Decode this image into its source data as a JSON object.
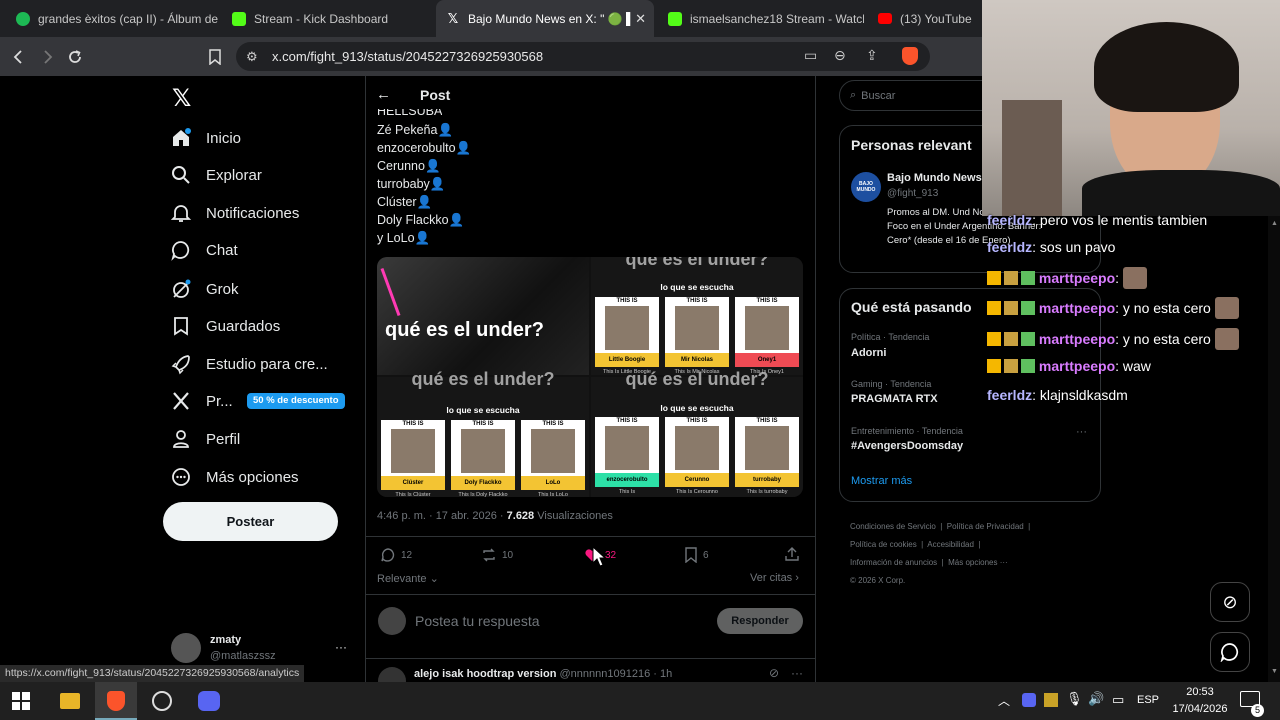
{
  "browser": {
    "tabs": [
      {
        "title": "grandes èxitos (cap II) - Álbum de",
        "favicon_color": "#1db954"
      },
      {
        "title": "Stream - Kick Dashboard",
        "favicon_color": "#53fc18"
      },
      {
        "title": "Bajo Mundo News en X: \" 🟢 ▌",
        "favicon_color": "#ffffff",
        "close": "✕"
      },
      {
        "title": "ismaelsanchez18 Stream - Watch",
        "favicon_color": "#53fc18"
      },
      {
        "title": "(13) YouTube",
        "favicon_color": "#ff0000"
      }
    ],
    "url": "x.com/fight_913/status/2045227326925930568",
    "status_url": "https://x.com/fight_913/status/2045227326925930568/analytics"
  },
  "nav": {
    "items": [
      {
        "label": "Inicio",
        "icon": "home-icon"
      },
      {
        "label": "Explorar",
        "icon": "search-icon"
      },
      {
        "label": "Notificaciones",
        "icon": "bell-icon"
      },
      {
        "label": "Chat",
        "icon": "chat-icon"
      },
      {
        "label": "Grok",
        "icon": "grok-icon"
      },
      {
        "label": "Guardados",
        "icon": "bookmark-icon"
      },
      {
        "label": "Estudio para cre...",
        "icon": "rocket-icon"
      },
      {
        "label": "Pr...",
        "icon": "x-logo-icon"
      },
      {
        "label": "Perfil",
        "icon": "person-icon"
      },
      {
        "label": "Más opciones",
        "icon": "more-circle-icon"
      }
    ],
    "premium_badge": "50 % de descuento",
    "post_button": "Postear",
    "account": {
      "name": "zmaty",
      "handle": "@matlaszssz",
      "more": "···"
    }
  },
  "post": {
    "header": "Post",
    "partial_line": "HELLSUBA",
    "lines": [
      "Zé Pekeña👤",
      "enzocerobulto👤",
      "Cerunno👤",
      "turrobaby👤",
      "Clúster👤",
      "Doly Flackko👤",
      "y LoLo👤"
    ],
    "image": {
      "big_title": "qué es el under?",
      "sub": "lo que se escucha",
      "this_is": "THIS IS",
      "top_cards": [
        "Little Boogie",
        "Mir Nicolas",
        "Oney1"
      ],
      "top_captions": [
        "This Is Little Boogie",
        "This Is Mir Nicolas",
        "This Is Oney1"
      ],
      "bottom_left_cards": [
        "Clúster",
        "Doly Flackko",
        "LoLo"
      ],
      "bottom_left_captions": [
        "This Is Clúster",
        "This Is Doly Flackko",
        "This Is LoLo"
      ],
      "bottom_right_cards": [
        "enzocerobulto",
        "Cerunno",
        "turrobaby"
      ],
      "bottom_right_captions": [
        "This Is",
        "This Is Cerounno",
        "This Is turrobaby"
      ]
    },
    "timestamp": "4:46 p. m. · 17 abr. 2026 ·",
    "views_count": "7.628",
    "views_label": "Visualizaciones",
    "replies": "12",
    "reposts": "10",
    "likes": "32",
    "bookmarks": "6",
    "relevance": "Relevante",
    "see_quotes": "Ver citas",
    "reply_placeholder": "Postea tu respuesta",
    "reply_button": "Responder",
    "next_reply": {
      "name": "alejo isak hoodtrap version",
      "handle": "@nnnnnn1091216 · 1h"
    }
  },
  "right": {
    "search_placeholder": "Buscar",
    "relevant_title": "Personas relevant",
    "relevant_person": {
      "name": "Bajo Mundo News",
      "handle": "@fight_913",
      "bio": "Promos al DM. Und Noticias y más. Foco en el Under Argentino. Banner: Cero* (desde el 16 de Enero)",
      "avatar_text": "BAJO MUNDO"
    },
    "trends_title": "Qué está pasando",
    "trends": [
      {
        "category": "Política · Tendencia",
        "name": "Adorni"
      },
      {
        "category": "Gaming · Tendencia",
        "name": "PRAGMATA RTX"
      },
      {
        "category": "Entretenimiento · Tendencia",
        "name": "#AvengersDoomsday"
      }
    ],
    "show_more": "Mostrar más",
    "footer": [
      [
        "Condiciones de Servicio",
        "Política de Privacidad"
      ],
      [
        "Política de cookies",
        "Accesibilidad"
      ],
      [
        "Información de anuncios",
        "Más opciones ···"
      ],
      [
        "© 2026 X Corp."
      ]
    ]
  },
  "chat": [
    {
      "user": "feerldz",
      "text": ": pero vos le mentis tambien"
    },
    {
      "user": "feerldz",
      "text": ": sos un pavo"
    },
    {
      "user": "marttpeepo",
      "text": ":"
    },
    {
      "user": "marttpeepo",
      "text": ": y no esta cero"
    },
    {
      "user": "marttpeepo",
      "text": ": y no esta cero"
    },
    {
      "user": "marttpeepo",
      "text": ": waw"
    },
    {
      "user": "feerldz",
      "text": ": klajnsldkasdm"
    }
  ],
  "taskbar": {
    "lang": "ESP",
    "time": "20:53",
    "date": "17/04/2026",
    "notif_count": "5"
  },
  "colors": {
    "x_blue": "#1d9bf0",
    "like_red": "#f91880",
    "premium": "#1d9bf0"
  }
}
